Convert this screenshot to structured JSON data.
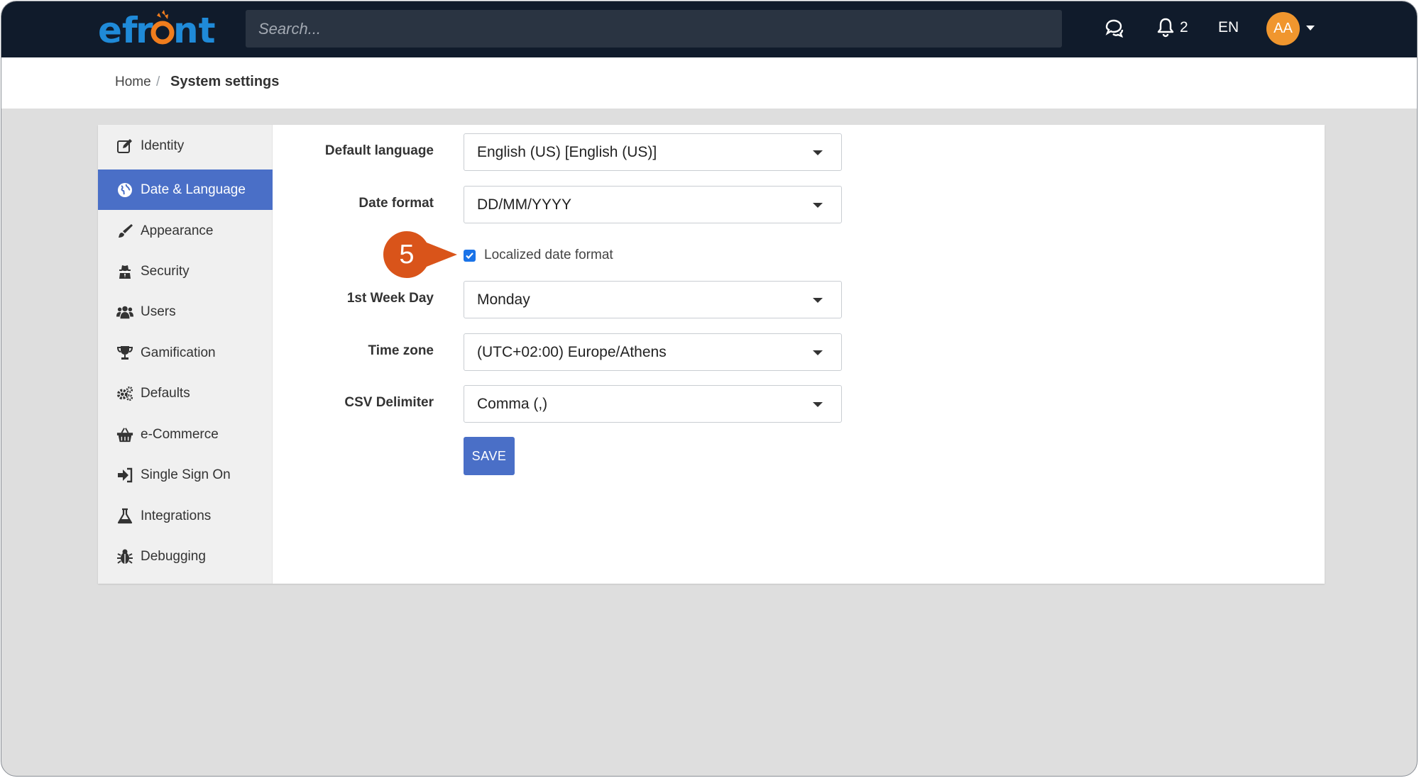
{
  "app": {
    "logo_text": "efront"
  },
  "topbar": {
    "search_placeholder": "Search...",
    "notifications_count": "2",
    "language": "EN",
    "avatar_initials": "AA",
    "avatar_color": "#f0962e"
  },
  "breadcrumb": {
    "home": "Home",
    "separator": "/",
    "current": "System settings"
  },
  "sidebar": {
    "items": [
      {
        "label": "Identity",
        "icon": "edit-icon"
      },
      {
        "label": "Date & Language",
        "icon": "globe-icon",
        "active": true
      },
      {
        "label": "Appearance",
        "icon": "brush-icon"
      },
      {
        "label": "Security",
        "icon": "spy-icon"
      },
      {
        "label": "Users",
        "icon": "users-icon"
      },
      {
        "label": "Gamification",
        "icon": "trophy-icon"
      },
      {
        "label": "Defaults",
        "icon": "gears-icon"
      },
      {
        "label": "e-Commerce",
        "icon": "basket-icon"
      },
      {
        "label": "Single Sign On",
        "icon": "sign-in-icon"
      },
      {
        "label": "Integrations",
        "icon": "flask-icon"
      },
      {
        "label": "Debugging",
        "icon": "bug-icon"
      }
    ]
  },
  "form": {
    "default_language": {
      "label": "Default language",
      "value": "English (US) [English (US)]"
    },
    "date_format": {
      "label": "Date format",
      "value": "DD/MM/YYYY"
    },
    "localized_date": {
      "label": "Localized date format",
      "checked": true
    },
    "first_week_day": {
      "label": "1st Week Day",
      "value": "Monday"
    },
    "time_zone": {
      "label": "Time zone",
      "value": "(UTC+02:00) Europe/Athens"
    },
    "csv_delimiter": {
      "label": "CSV Delimiter",
      "value": "Comma (,)"
    },
    "save_label": "SAVE"
  },
  "callout": {
    "number": "5",
    "color": "#d9541a"
  },
  "colors": {
    "accent": "#4a6fc7",
    "topbar": "#101b2b"
  }
}
